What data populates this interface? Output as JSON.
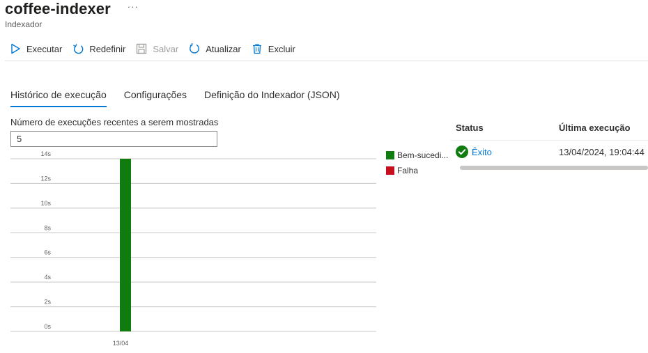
{
  "header": {
    "title": "coffee-indexer",
    "more": "···",
    "subtitle": "Indexador"
  },
  "toolbar": {
    "run": "Executar",
    "reset": "Redefinir",
    "save": "Salvar",
    "refresh": "Atualizar",
    "delete": "Excluir"
  },
  "tabs": [
    "Histórico de execução",
    "Configurações",
    "Definição do Indexador (JSON)"
  ],
  "runs": {
    "label": "Número de execuções recentes a serem mostradas",
    "value": "5"
  },
  "chart_data": {
    "type": "bar",
    "categories": [
      "13/04"
    ],
    "series": [
      {
        "name": "Bem-sucedi...",
        "color": "#107c10",
        "values": [
          14
        ]
      },
      {
        "name": "Falha",
        "color": "#c50f1f",
        "values": [
          0
        ]
      }
    ],
    "yticks": [
      "0s",
      "2s",
      "4s",
      "6s",
      "8s",
      "10s",
      "12s",
      "14s"
    ],
    "ylim": [
      0,
      14
    ],
    "grid": true,
    "legend": "right"
  },
  "table": {
    "headers": [
      "Status",
      "Última execução"
    ],
    "rows": [
      {
        "status": "Êxito",
        "time": "13/04/2024, 19:04:44"
      }
    ]
  },
  "colors": {
    "accent": "#0078d4",
    "success": "#107c10",
    "failure": "#c50f1f"
  }
}
